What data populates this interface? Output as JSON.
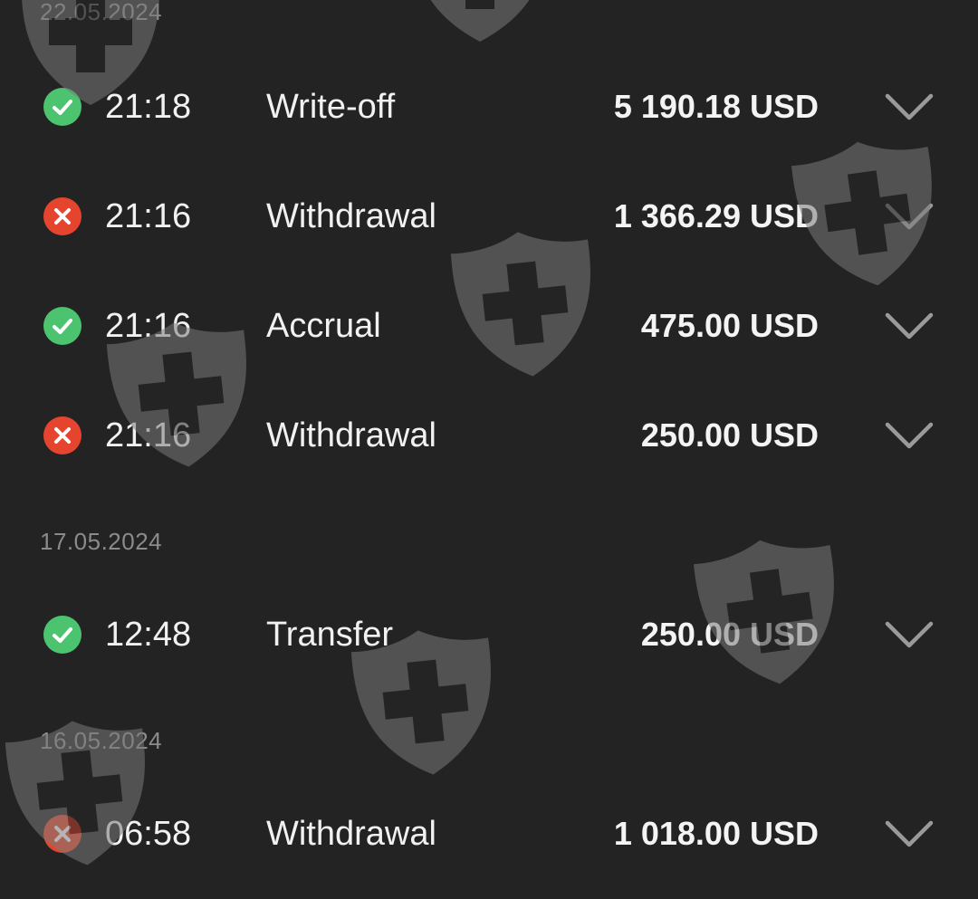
{
  "groups": [
    {
      "date": "22.05.2024",
      "transactions": [
        {
          "status": "success",
          "time": "21:18",
          "type": "Write-off",
          "amount": "5 190.18 USD"
        },
        {
          "status": "failed",
          "time": "21:16",
          "type": "Withdrawal",
          "amount": "1 366.29 USD"
        },
        {
          "status": "success",
          "time": "21:16",
          "type": "Accrual",
          "amount": "475.00 USD"
        },
        {
          "status": "failed",
          "time": "21:16",
          "type": "Withdrawal",
          "amount": "250.00 USD"
        }
      ]
    },
    {
      "date": "17.05.2024",
      "transactions": [
        {
          "status": "success",
          "time": "12:48",
          "type": "Transfer",
          "amount": "250.00 USD"
        }
      ]
    },
    {
      "date": "16.05.2024",
      "transactions": [
        {
          "status": "failed",
          "time": "06:58",
          "type": "Withdrawal",
          "amount": "1 018.00 USD"
        }
      ]
    }
  ],
  "icons": {
    "success": "check-circle-icon",
    "failed": "x-circle-icon",
    "expand": "chevron-down-icon",
    "watermark": "shield-cross-icon"
  },
  "colors": {
    "background": "#232323",
    "success": "#4cc46f",
    "failed": "#e5452e",
    "date_text": "#8b8b8b",
    "primary_text": "#f1f1f1",
    "chevron": "#9a9a9a"
  }
}
